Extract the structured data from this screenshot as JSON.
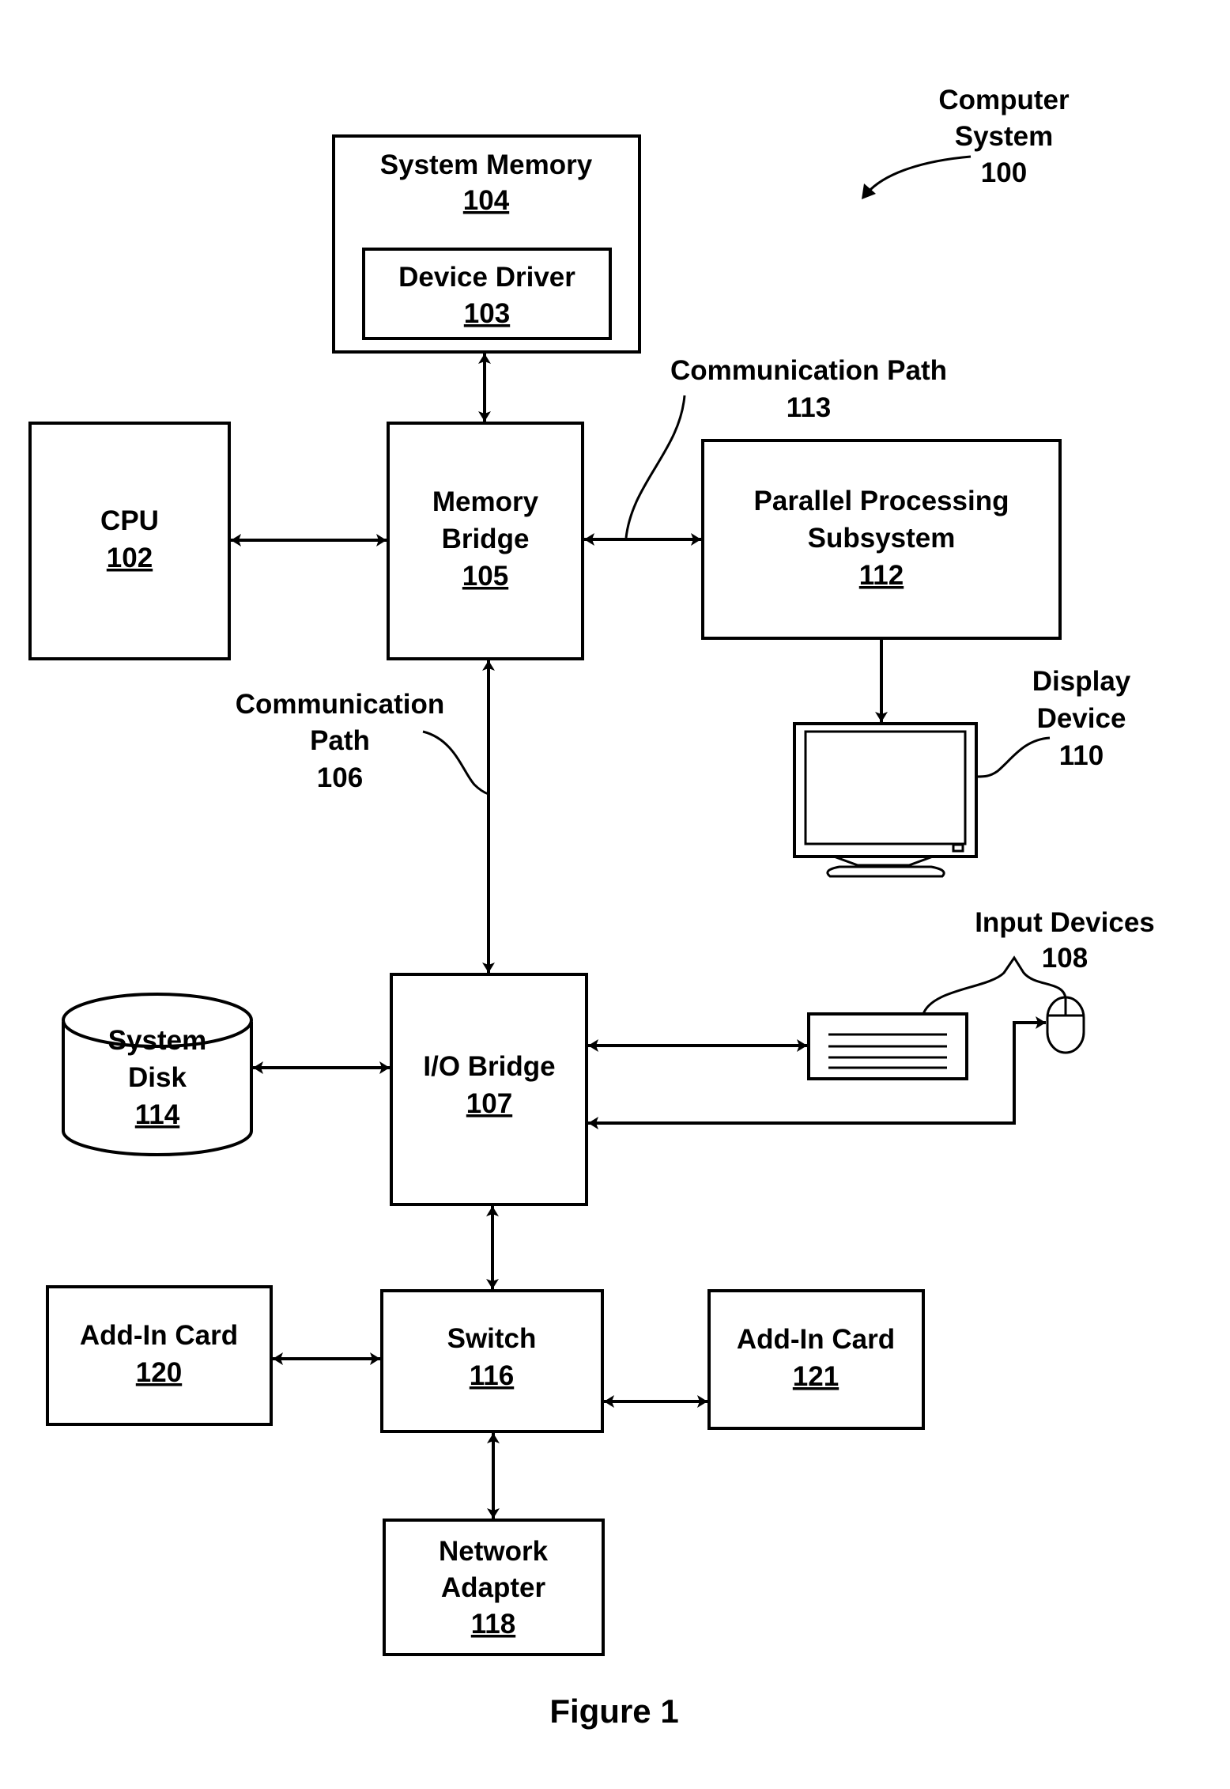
{
  "figure": {
    "caption": "Figure 1",
    "system_label": [
      "Computer",
      "System",
      "100"
    ]
  },
  "blocks": {
    "system_memory": {
      "title": "System Memory",
      "ref": "104"
    },
    "device_driver": {
      "title": "Device Driver",
      "ref": "103"
    },
    "cpu": {
      "title": "CPU",
      "ref": "102"
    },
    "memory_bridge": {
      "title": [
        "Memory",
        "Bridge"
      ],
      "ref": "105"
    },
    "parallel_processing": {
      "title": [
        "Parallel Processing",
        "Subsystem"
      ],
      "ref": "112"
    },
    "io_bridge": {
      "title": "I/O Bridge",
      "ref": "107"
    },
    "system_disk": {
      "title": [
        "System",
        "Disk"
      ],
      "ref": "114"
    },
    "switch": {
      "title": "Switch",
      "ref": "116"
    },
    "add_in_card_120": {
      "title": "Add-In Card",
      "ref": "120"
    },
    "add_in_card_121": {
      "title": "Add-In Card",
      "ref": "121"
    },
    "network_adapter": {
      "title": [
        "Network",
        "Adapter"
      ],
      "ref": "118"
    }
  },
  "callouts": {
    "comm_path_113": [
      "Communication Path",
      "113"
    ],
    "comm_path_106": [
      "Communication",
      "Path",
      "106"
    ],
    "display_device": [
      "Display",
      "Device",
      "110"
    ],
    "input_devices": [
      "Input Devices",
      "108"
    ]
  }
}
